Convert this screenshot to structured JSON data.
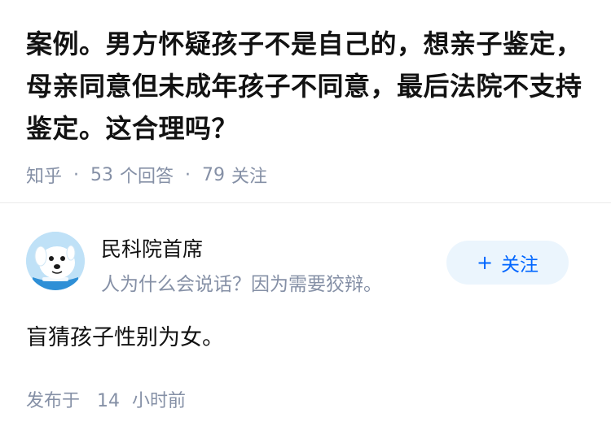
{
  "question": {
    "title": "案例。男方怀疑孩子不是自己的，想亲子鉴定，母亲同意但未成年孩子不同意，最后法院不支持鉴定。这合理吗？",
    "source": "知乎",
    "separator": "·",
    "answers_count": "53",
    "answers_label": "个回答",
    "followers_count": "79",
    "followers_label": "关注"
  },
  "author": {
    "name": "民科院首席",
    "bio": "人为什么会说话？因为需要狡辩。",
    "avatar_icon": "cartoon-dog-avatar",
    "follow_button": {
      "plus": "+",
      "label": "关注"
    }
  },
  "answer": {
    "content": "盲猜孩子性别为女。",
    "published_label": "发布于",
    "published_number": "14",
    "published_unit": "小时前"
  },
  "colors": {
    "text_primary": "#121212",
    "text_secondary": "#8590a6",
    "accent": "#0066ff",
    "follow_bg": "#ebf5fd",
    "divider": "#ebebeb"
  }
}
